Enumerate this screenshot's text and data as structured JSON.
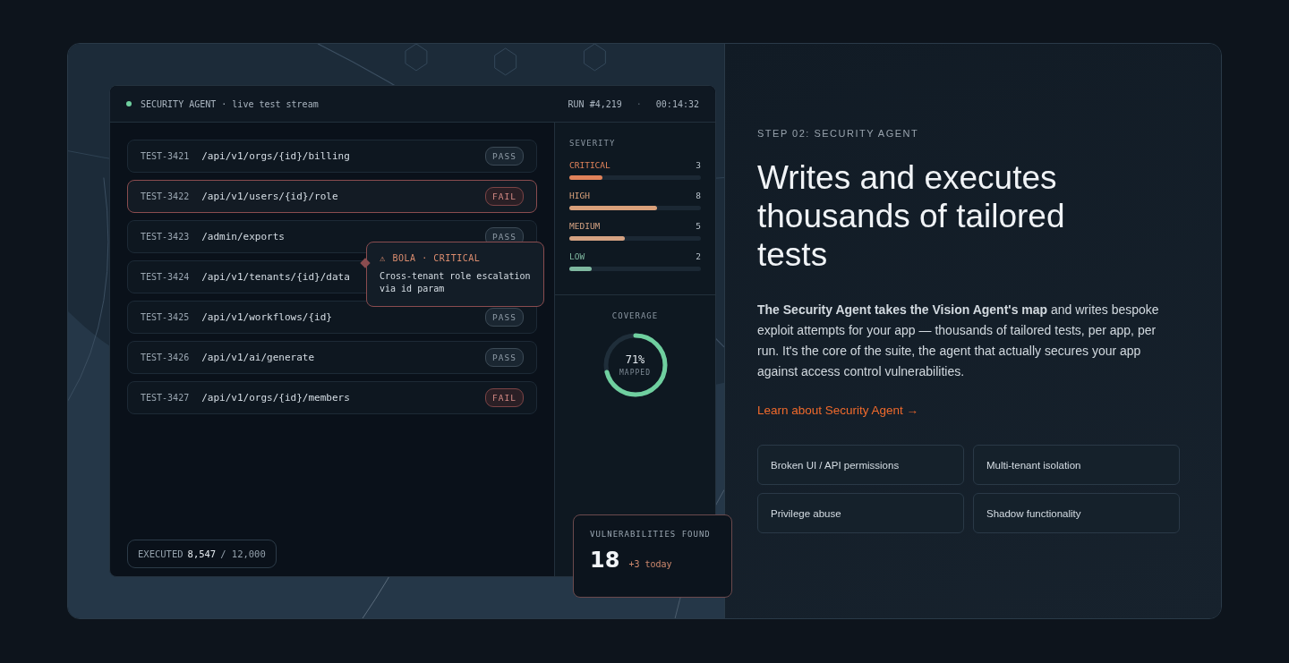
{
  "console": {
    "live": true,
    "title": "SECURITY AGENT",
    "subtitle": "· live test stream",
    "run": "RUN #4,219",
    "separator": "·",
    "elapsed": "00:14:32",
    "tests": [
      {
        "id": "TEST-3421",
        "path": "/api/v1/orgs/{id}/billing",
        "status": "PASS",
        "kind": "pass",
        "selected": false
      },
      {
        "id": "TEST-3422",
        "path": "/api/v1/users/{id}/role",
        "status": "FAIL",
        "kind": "fail",
        "selected": true
      },
      {
        "id": "TEST-3423",
        "path": "/admin/exports",
        "status": "PASS",
        "kind": "pass",
        "selected": false
      },
      {
        "id": "TEST-3424",
        "path": "/api/v1/tenants/{id}/data",
        "selected": false
      },
      {
        "id": "TEST-3425",
        "path": "/api/v1/workflows/{id}",
        "status": "PASS",
        "kind": "pass",
        "selected": false
      },
      {
        "id": "TEST-3426",
        "path": "/api/v1/ai/generate",
        "status": "PASS",
        "kind": "pass",
        "selected": false
      },
      {
        "id": "TEST-3427",
        "path": "/api/v1/orgs/{id}/members",
        "status": "FAIL",
        "kind": "fail",
        "selected": false
      }
    ],
    "tooltip": {
      "icon": "⚠",
      "title": "BOLA · CRITICAL",
      "text": "Cross-tenant role escalation via id param"
    },
    "executed": {
      "label": "EXECUTED",
      "done": "8,547",
      "total": "/ 12,000"
    },
    "severity": {
      "title": "SEVERITY",
      "levels": [
        {
          "name": "CRITICAL",
          "count": "3",
          "level": 0.25,
          "color": "#e0825a"
        },
        {
          "name": "HIGH",
          "count": "8",
          "level": 0.67,
          "color": "#d9a07a"
        },
        {
          "name": "MEDIUM",
          "count": "5",
          "level": 0.42,
          "color": "#d4a282"
        },
        {
          "name": "LOW",
          "count": "2",
          "level": 0.17,
          "color": "#7fb8a0"
        }
      ]
    },
    "coverage": {
      "title": "COVERAGE",
      "value": "71%",
      "caption": "MAPPED",
      "level": 0.71
    },
    "vulnerabilities": {
      "title": "VULNERABILITIES FOUND",
      "count": "18",
      "delta": "+3 today"
    }
  },
  "content": {
    "step": "STEP 02: SECURITY AGENT",
    "heading": "Writes and executes thousands of tailored tests",
    "paragraph": "**The Security Agent takes the Vision Agent's map** and writes bespoke exploit attempts for your app — thousands of tailored tests, per app, per run. It's the core of the suite, the agent that actually secures your app against access control vulnerabilities.",
    "link": "Learn about Security Agent →",
    "tags": [
      "Broken UI / API permissions",
      "Multi-tenant isolation",
      "Privilege abuse",
      "Shadow functionality"
    ]
  }
}
